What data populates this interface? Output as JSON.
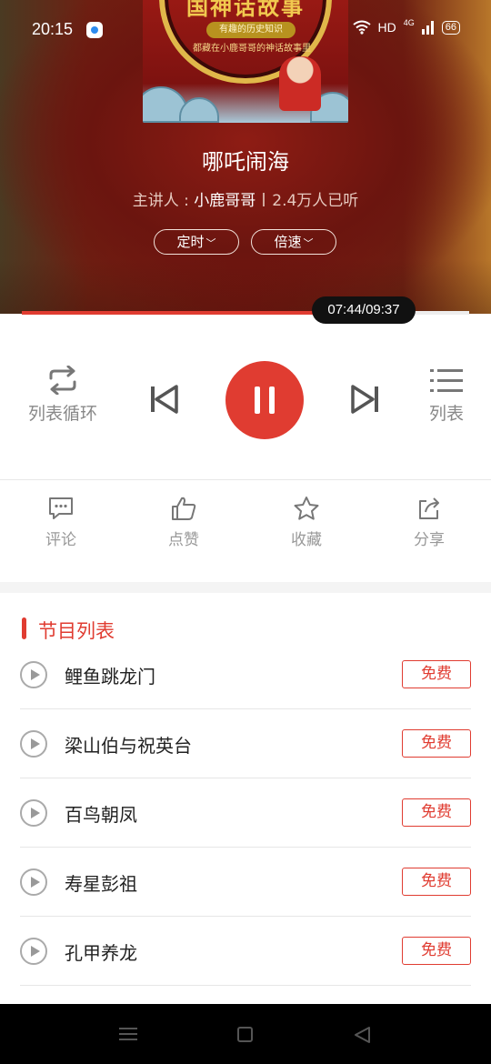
{
  "status": {
    "time": "20:15",
    "network": "HD",
    "signal": "4G",
    "battery": "66"
  },
  "cover": {
    "title_glyphs": "国神话故事",
    "badge": "有趣的历史知识",
    "subtitle": "都藏在小鹿哥哥的神话故事里"
  },
  "track": {
    "title": "哪吒闹海",
    "host_prefix": "主讲人 : ",
    "host": "小鹿哥哥",
    "listens": "2.4万人已听"
  },
  "pills": {
    "timer": "定时",
    "speed": "倍速"
  },
  "progress": {
    "fraction": 0.79,
    "time_label": "07:44/09:37"
  },
  "controls": {
    "loop_label": "列表循环",
    "list_label": "列表"
  },
  "actions": {
    "comment": "评论",
    "like": "点赞",
    "favorite": "收藏",
    "share": "分享"
  },
  "section": {
    "title": "节目列表"
  },
  "episodes": [
    {
      "title": "鲤鱼跳龙门",
      "tag": "免费"
    },
    {
      "title": "梁山伯与祝英台",
      "tag": "免费"
    },
    {
      "title": "百鸟朝凤",
      "tag": "免费"
    },
    {
      "title": "寿星彭祖",
      "tag": "免费"
    },
    {
      "title": "孔甲养龙",
      "tag": "免费"
    }
  ],
  "colors": {
    "accent": "#e03c31",
    "muted": "#999999"
  }
}
